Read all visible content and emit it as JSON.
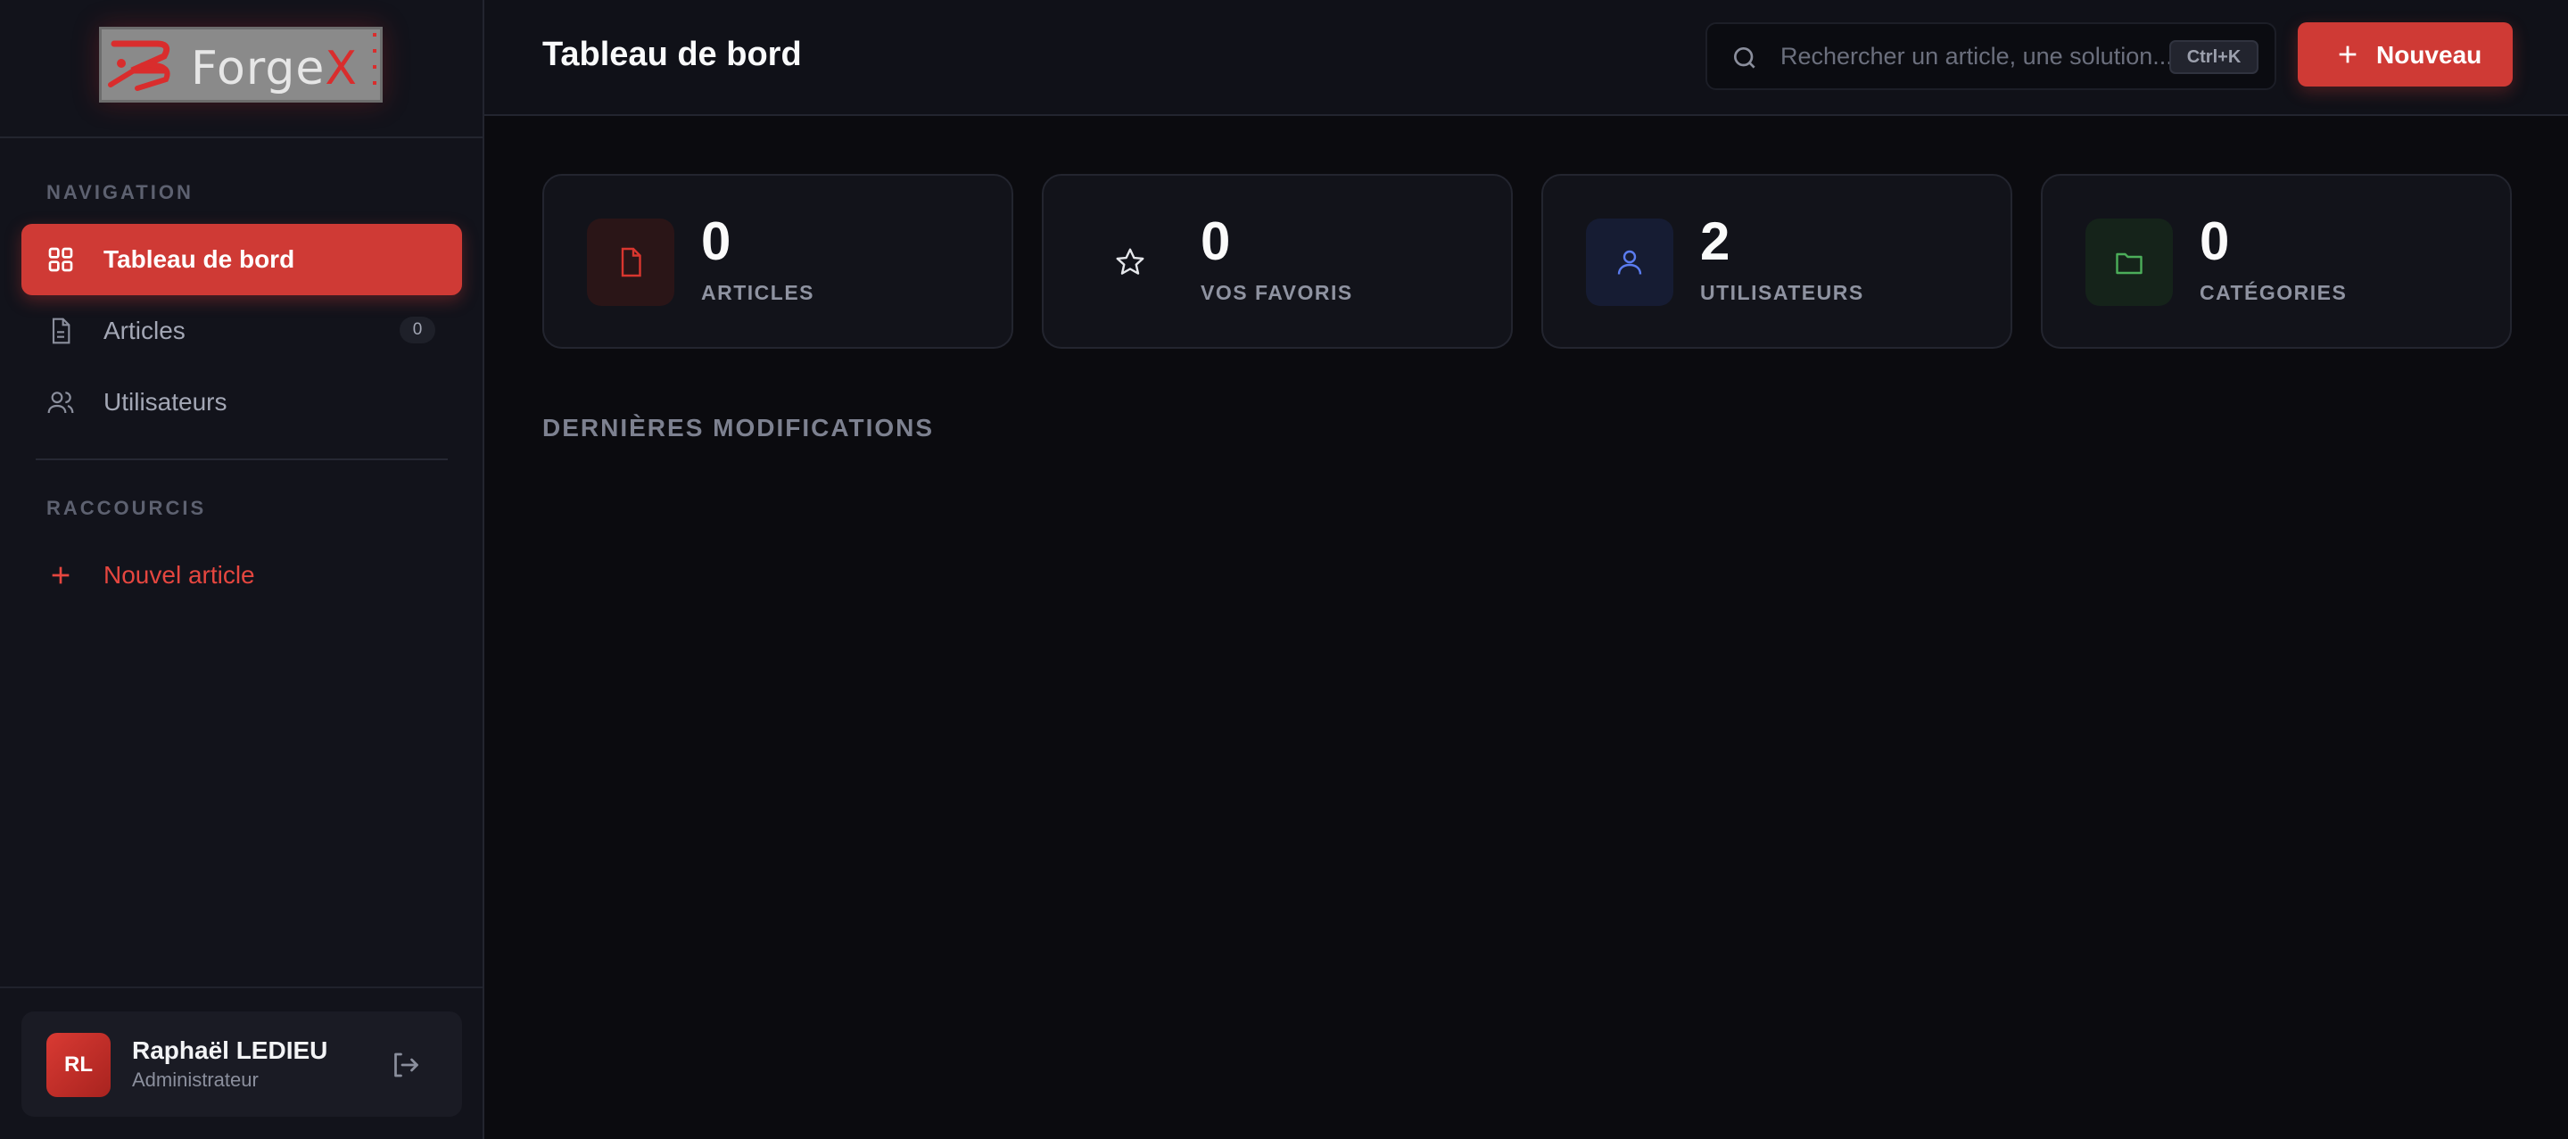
{
  "brand": {
    "logo_text_main": "Forge",
    "logo_text_accent": "X"
  },
  "sidebar": {
    "nav_section_label": "NAVIGATION",
    "items": [
      {
        "label": "Tableau de bord",
        "icon": "grid-icon",
        "active": true
      },
      {
        "label": "Articles",
        "icon": "document-icon",
        "badge": "0"
      },
      {
        "label": "Utilisateurs",
        "icon": "users-icon"
      }
    ],
    "shortcuts_section_label": "RACCOURCIS",
    "shortcuts": [
      {
        "label": "Nouvel article",
        "icon": "plus-icon"
      }
    ]
  },
  "user": {
    "initials": "RL",
    "name": "Raphaël LEDIEU",
    "role": "Administrateur"
  },
  "header": {
    "title": "Tableau de bord",
    "search_placeholder": "Rechercher un article, une solution...",
    "search_shortcut": "Ctrl+K",
    "new_button_label": "Nouveau"
  },
  "stats": [
    {
      "value": "0",
      "label": "ARTICLES",
      "icon": "document-icon",
      "color": "#d9362f"
    },
    {
      "value": "0",
      "label": "VOS FAVORIS",
      "icon": "star-icon",
      "color": "#e5e7eb"
    },
    {
      "value": "2",
      "label": "UTILISATEURS",
      "icon": "user-icon",
      "color": "#5b7cf0"
    },
    {
      "value": "0",
      "label": "CATÉGORIES",
      "icon": "folder-icon",
      "color": "#4cae5a"
    }
  ],
  "main": {
    "recent_section_title": "DERNIÈRES MODIFICATIONS"
  },
  "colors": {
    "accent": "#cf3a35",
    "background": "#0b0b0f",
    "sidebar": "#12131b"
  }
}
